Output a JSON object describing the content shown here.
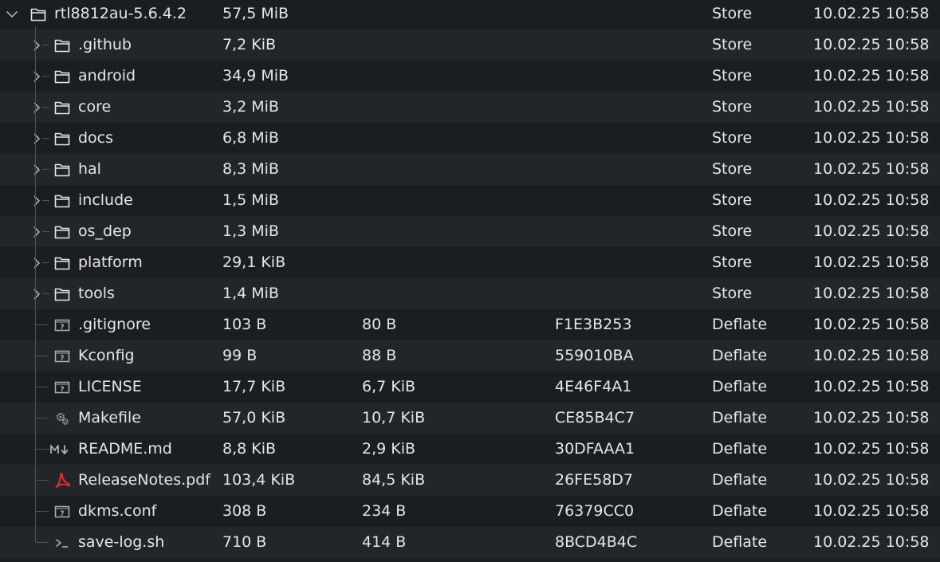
{
  "tree": {
    "root": {
      "name": "rtl8812au-5.6.4.2",
      "size": "57,5 MiB",
      "packed": "",
      "crc": "",
      "method": "Store",
      "modified": "10.02.25 10:58",
      "icon": "folder-icon",
      "expander": "chevron-down-icon"
    },
    "items": [
      {
        "name": ".github",
        "size": "7,2 KiB",
        "packed": "",
        "crc": "",
        "method": "Store",
        "modified": "10.02.25 10:58",
        "icon": "folder-icon"
      },
      {
        "name": "android",
        "size": "34,9 MiB",
        "packed": "",
        "crc": "",
        "method": "Store",
        "modified": "10.02.25 10:58",
        "icon": "folder-icon"
      },
      {
        "name": "core",
        "size": "3,2 MiB",
        "packed": "",
        "crc": "",
        "method": "Store",
        "modified": "10.02.25 10:58",
        "icon": "folder-icon"
      },
      {
        "name": "docs",
        "size": "6,8 MiB",
        "packed": "",
        "crc": "",
        "method": "Store",
        "modified": "10.02.25 10:58",
        "icon": "folder-icon"
      },
      {
        "name": "hal",
        "size": "8,3 MiB",
        "packed": "",
        "crc": "",
        "method": "Store",
        "modified": "10.02.25 10:58",
        "icon": "folder-icon"
      },
      {
        "name": "include",
        "size": "1,5 MiB",
        "packed": "",
        "crc": "",
        "method": "Store",
        "modified": "10.02.25 10:58",
        "icon": "folder-icon"
      },
      {
        "name": "os_dep",
        "size": "1,3 MiB",
        "packed": "",
        "crc": "",
        "method": "Store",
        "modified": "10.02.25 10:58",
        "icon": "folder-icon"
      },
      {
        "name": "platform",
        "size": "29,1 KiB",
        "packed": "",
        "crc": "",
        "method": "Store",
        "modified": "10.02.25 10:58",
        "icon": "folder-icon"
      },
      {
        "name": "tools",
        "size": "1,4 MiB",
        "packed": "",
        "crc": "",
        "method": "Store",
        "modified": "10.02.25 10:58",
        "icon": "folder-icon"
      },
      {
        "name": ".gitignore",
        "size": "103 B",
        "packed": "80 B",
        "crc": "F1E3B253",
        "method": "Deflate",
        "modified": "10.02.25 10:58",
        "icon": "unknown-file-icon"
      },
      {
        "name": "Kconfig",
        "size": "99 B",
        "packed": "88 B",
        "crc": "559010BA",
        "method": "Deflate",
        "modified": "10.02.25 10:58",
        "icon": "unknown-file-icon"
      },
      {
        "name": "LICENSE",
        "size": "17,7 KiB",
        "packed": "6,7 KiB",
        "crc": "4E46F4A1",
        "method": "Deflate",
        "modified": "10.02.25 10:58",
        "icon": "unknown-file-icon"
      },
      {
        "name": "Makefile",
        "size": "57,0 KiB",
        "packed": "10,7 KiB",
        "crc": "CE85B4C7",
        "method": "Deflate",
        "modified": "10.02.25 10:58",
        "icon": "gears-icon"
      },
      {
        "name": "README.md",
        "size": "8,8 KiB",
        "packed": "2,9 KiB",
        "crc": "30DFAAA1",
        "method": "Deflate",
        "modified": "10.02.25 10:58",
        "icon": "markdown-icon"
      },
      {
        "name": "ReleaseNotes.pdf",
        "size": "103,4 KiB",
        "packed": "84,5 KiB",
        "crc": "26FE58D7",
        "method": "Deflate",
        "modified": "10.02.25 10:58",
        "icon": "pdf-icon"
      },
      {
        "name": "dkms.conf",
        "size": "308 B",
        "packed": "234 B",
        "crc": "76379CC0",
        "method": "Deflate",
        "modified": "10.02.25 10:58",
        "icon": "unknown-file-icon"
      },
      {
        "name": "save-log.sh",
        "size": "710 B",
        "packed": "414 B",
        "crc": "8BCD4B4C",
        "method": "Deflate",
        "modified": "10.02.25 10:58",
        "icon": "terminal-icon"
      }
    ]
  },
  "colors": {
    "background": "#1b1e20",
    "row_alternate": "#232629",
    "text": "#e4e6e8",
    "guide_lines": "#4d5256",
    "pdf_icon": "#e2302c"
  }
}
